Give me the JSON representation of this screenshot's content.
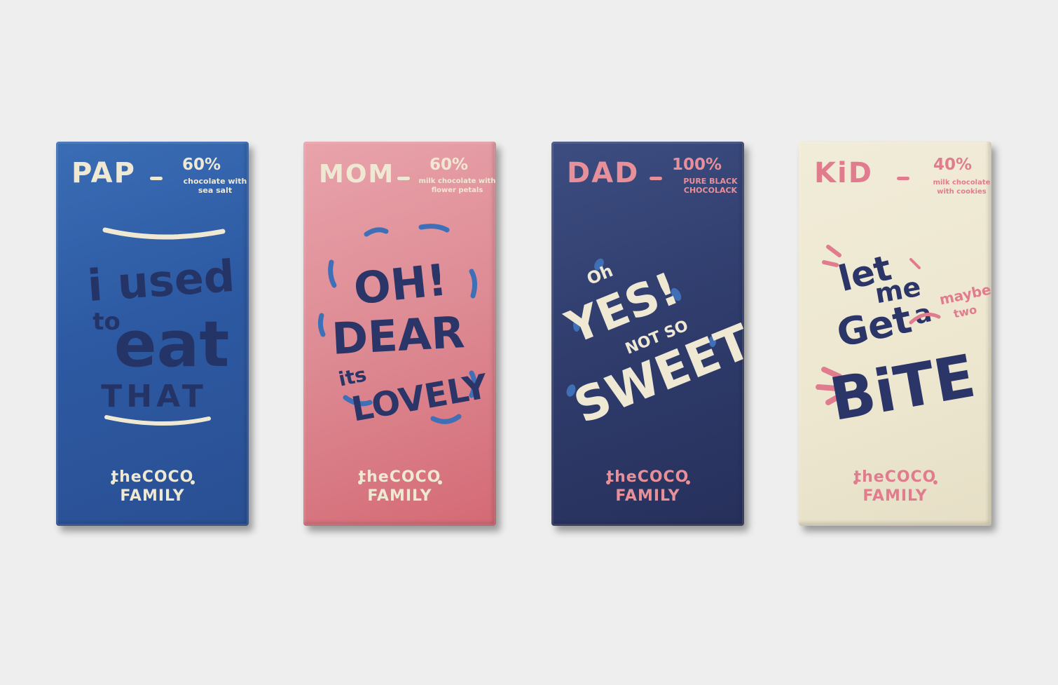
{
  "bars": [
    {
      "name": "PAP",
      "percent": "60%",
      "desc_line1": "chocolate with",
      "desc_line2": "sea salt",
      "art_words": [
        "i used",
        "to",
        "eat",
        "THAT"
      ],
      "brand_top": "theCOCO",
      "brand_bottom": "FAMILY",
      "colors": {
        "bg": "#2d5aa3",
        "text": "#efe9d4",
        "art": "#243467"
      }
    },
    {
      "name": "MOM",
      "percent": "60%",
      "desc_line1": "milk chocolate with",
      "desc_line2": "flower petals",
      "art_words": [
        "OH!",
        "DEAR",
        "its",
        "LOVELY"
      ],
      "brand_top": "theCOCO",
      "brand_bottom": "FAMILY",
      "colors": {
        "bg": "#dd8a93",
        "text": "#efe9d4",
        "art": "#2b3567",
        "accent": "#3f6fb6"
      }
    },
    {
      "name": "DAD",
      "percent": "100%",
      "desc_line1": "PURE BLACK",
      "desc_line2": "CHOCOLACK",
      "art_words": [
        "Oh",
        "YES!",
        "NOT SO",
        "SWEET"
      ],
      "brand_top": "theCOCO",
      "brand_bottom": "FAMILY",
      "colors": {
        "bg": "#2f3c6c",
        "text": "#e7909a",
        "art": "#efe9d4",
        "accent": "#3f6fb6"
      }
    },
    {
      "name": "KiD",
      "percent": "40%",
      "desc_line1": "milk chocolate",
      "desc_line2": "with cookies",
      "art_words": [
        "let",
        "me",
        "Get",
        "a",
        "maybe",
        "two",
        "BiTE"
      ],
      "brand_top": "theCOCO",
      "brand_bottom": "FAMILY",
      "colors": {
        "bg": "#ede7d0",
        "text": "#e07c8e",
        "art": "#2b3567"
      }
    }
  ]
}
